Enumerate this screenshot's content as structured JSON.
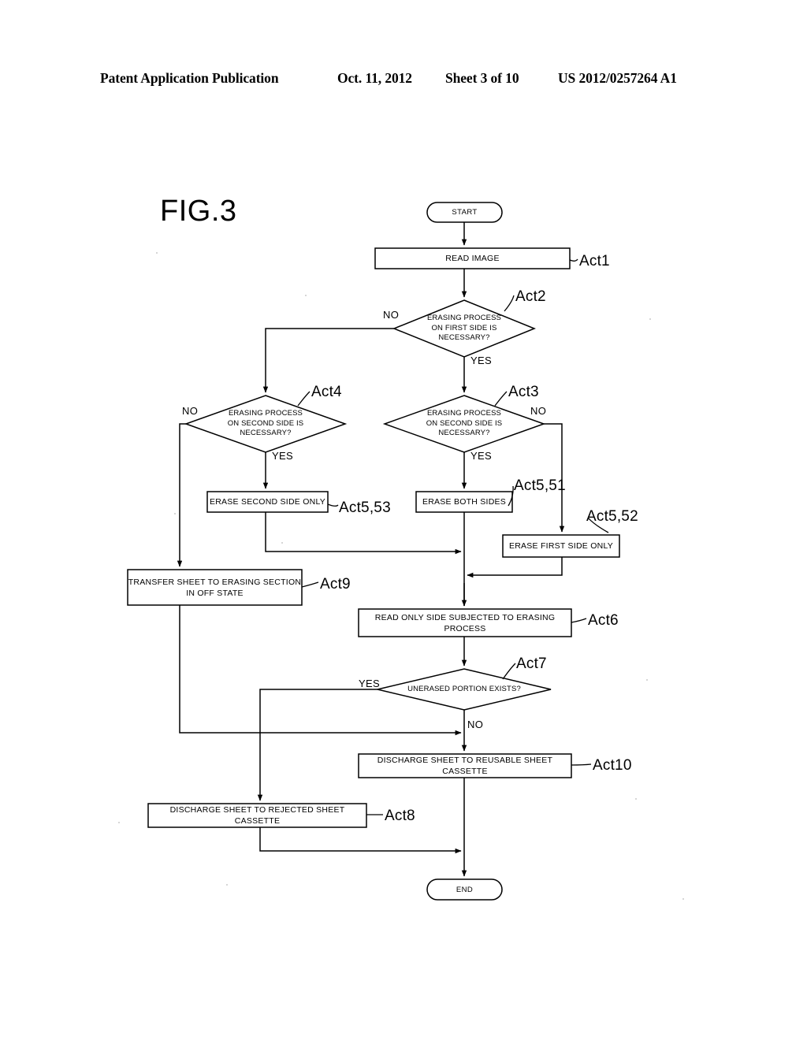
{
  "header": {
    "publication": "Patent Application Publication",
    "date": "Oct. 11, 2012",
    "sheet": "Sheet 3 of 10",
    "document_number": "US 2012/0257264 A1"
  },
  "figure": {
    "label": "FIG.3"
  },
  "flowchart": {
    "nodes": {
      "start": {
        "text": "START"
      },
      "end": {
        "text": "END"
      },
      "act1": {
        "text": "READ IMAGE",
        "ref": "Act1"
      },
      "act2": {
        "line1": "ERASING PROCESS",
        "line2": "ON FIRST SIDE IS",
        "line3": "NECESSARY?",
        "ref": "Act2"
      },
      "act3": {
        "line1": "ERASING PROCESS",
        "line2": "ON SECOND SIDE IS",
        "line3": "NECESSARY?",
        "ref": "Act3"
      },
      "act4": {
        "line1": "ERASING PROCESS",
        "line2": "ON SECOND SIDE IS",
        "line3": "NECESSARY?",
        "ref": "Act4"
      },
      "act5_51": {
        "text": "ERASE BOTH SIDES",
        "ref": "Act5,51"
      },
      "act5_52": {
        "text": "ERASE FIRST SIDE ONLY",
        "ref": "Act5,52"
      },
      "act5_53": {
        "text": "ERASE SECOND SIDE ONLY",
        "ref": "Act5,53"
      },
      "act6": {
        "line1": "READ ONLY SIDE SUBJECTED TO ERASING",
        "line2": "PROCESS",
        "ref": "Act6"
      },
      "act7": {
        "text": "UNERASED PORTION EXISTS?",
        "ref": "Act7"
      },
      "act8": {
        "text": "DISCHARGE SHEET TO REJECTED SHEET CASSETTE",
        "ref": "Act8"
      },
      "act9": {
        "line1": "TRANSFER SHEET TO ERASING SECTION",
        "line2": "IN OFF STATE",
        "ref": "Act9"
      },
      "act10": {
        "text": "DISCHARGE SHEET TO REUSABLE SHEET CASSETTE",
        "ref": "Act10"
      }
    },
    "branches": {
      "act2_no": "NO",
      "act2_yes": "YES",
      "act3_no": "NO",
      "act3_yes": "YES",
      "act4_no": "NO",
      "act4_yes": "YES",
      "act7_yes": "YES",
      "act7_no": "NO"
    }
  },
  "colors": {
    "ink": "#000000",
    "paper": "#ffffff"
  }
}
